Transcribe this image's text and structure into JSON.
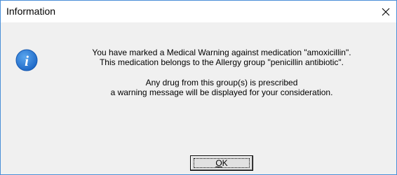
{
  "window": {
    "title": "Information"
  },
  "icons": {
    "info": "information-icon",
    "close": "close-icon"
  },
  "message": {
    "line1": "You have marked a Medical Warning against medication \"amoxicillin\".",
    "line2": "This medication belongs to the Allergy group \"penicillin antibiotic\".",
    "line3": "Any drug from this group(s) is prescribed",
    "line4": "a warning message will be  displayed for your consideration."
  },
  "buttons": {
    "ok_mnemonic": "O",
    "ok_rest": "K"
  },
  "colors": {
    "window_border": "#4a8fd8",
    "dialog_bg": "#f0f0f0",
    "icon_blue": "#2b7fd9"
  }
}
